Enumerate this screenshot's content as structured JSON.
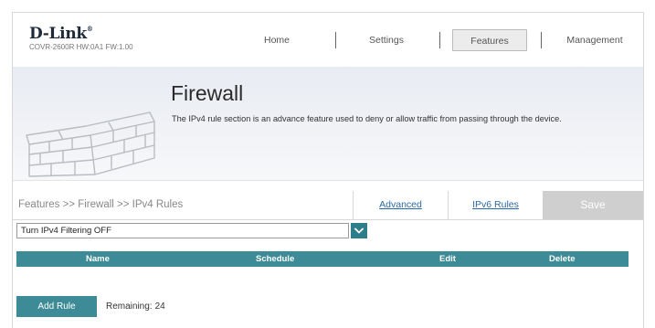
{
  "brand": {
    "logo": "D-Link",
    "logo_mark": "®",
    "model_info": "COVR-2600R HW:0A1 FW:1.00"
  },
  "nav": {
    "items": [
      "Home",
      "Settings",
      "Features",
      "Management"
    ],
    "active": "Features"
  },
  "banner": {
    "title": "Firewall",
    "description": "The IPv4 rule section is an advance feature used to deny or allow traffic from passing through the device."
  },
  "breadcrumb": "Features >> Firewall >> IPv4 Rules",
  "tabs": {
    "advanced": "Advanced",
    "ipv6": "IPv6 Rules",
    "save": "Save"
  },
  "filter": {
    "selected": "Turn IPv4 Filtering OFF"
  },
  "table": {
    "headers": [
      "Name",
      "Schedule",
      "Edit",
      "Delete"
    ]
  },
  "add_rule": {
    "button": "Add Rule",
    "remaining_label": "Remaining:",
    "remaining_count": "24"
  },
  "colors": {
    "accent": "#3d8b96",
    "link": "#2b6aa8",
    "save_disabled": "#cfcfcf"
  }
}
